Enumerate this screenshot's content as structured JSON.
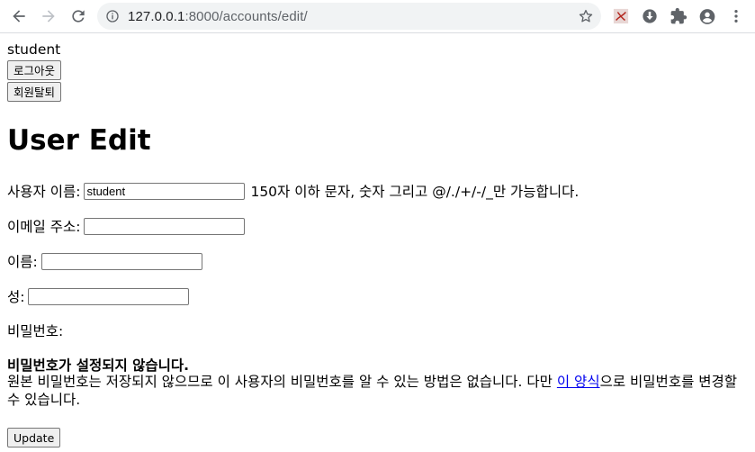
{
  "browser": {
    "url_host": "127.0.0.1",
    "url_port_path": ":8000/accounts/edit/",
    "icons": [
      "back-icon",
      "forward-icon",
      "reload-icon",
      "info-icon",
      "star-icon",
      "pdf-extension-icon",
      "download-extension-icon",
      "puzzle-icon",
      "profile-icon",
      "kebab-menu-icon"
    ]
  },
  "header": {
    "username": "student",
    "logout_label": "로그아웃",
    "withdraw_label": "회원탈퇴"
  },
  "page_title": "User Edit",
  "form": {
    "username": {
      "label": "사용자 이름:",
      "value": "student",
      "help": "150자 이하 문자, 숫자 그리고 @/./+/-/_만 가능합니다."
    },
    "email": {
      "label": "이메일 주소:",
      "value": ""
    },
    "first_name": {
      "label": "이름:",
      "value": ""
    },
    "last_name": {
      "label": "성:",
      "value": ""
    },
    "password": {
      "label": "비밀번호:",
      "status": "비밀번호가 설정되지 않습니다.",
      "text_before": "원본 비밀번호는 저장되지 않으므로 이 사용자의 비밀번호를 알 수 있는 방법은 없습니다. 다만 ",
      "link_text": "이 양식",
      "text_after": "으로 비밀번호를 변경할 수 있습니다."
    },
    "submit_label": "Update"
  },
  "colors": {
    "link": "#0000ee",
    "omnibox_bg": "#f1f3f4",
    "icon": "#5f6368",
    "pdf_red": "#b3261e"
  }
}
